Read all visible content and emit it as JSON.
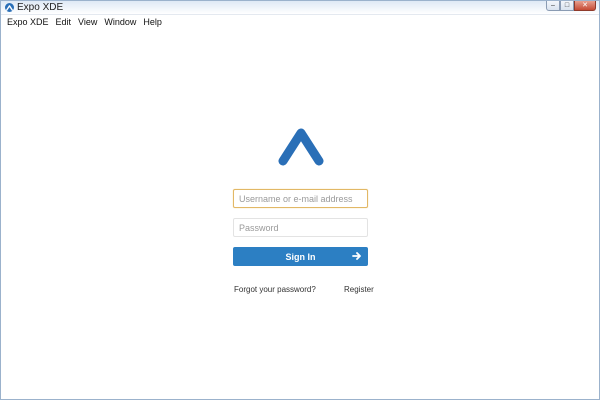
{
  "window": {
    "title": "Expo XDE",
    "icon": "expo-app-icon",
    "controls": {
      "minimize": "–",
      "maximize": "□",
      "close": "✕"
    }
  },
  "menubar": {
    "items": [
      {
        "label": "Expo XDE"
      },
      {
        "label": "Edit"
      },
      {
        "label": "View"
      },
      {
        "label": "Window"
      },
      {
        "label": "Help"
      }
    ]
  },
  "login": {
    "logo": "expo-logo-icon",
    "username_placeholder": "Username or e-mail address",
    "password_placeholder": "Password",
    "signin_label": "Sign In",
    "forgot_label": "Forgot your password?",
    "register_label": "Register"
  },
  "colors": {
    "accent": "#2c7fc3",
    "focus_border": "#e2b866"
  }
}
